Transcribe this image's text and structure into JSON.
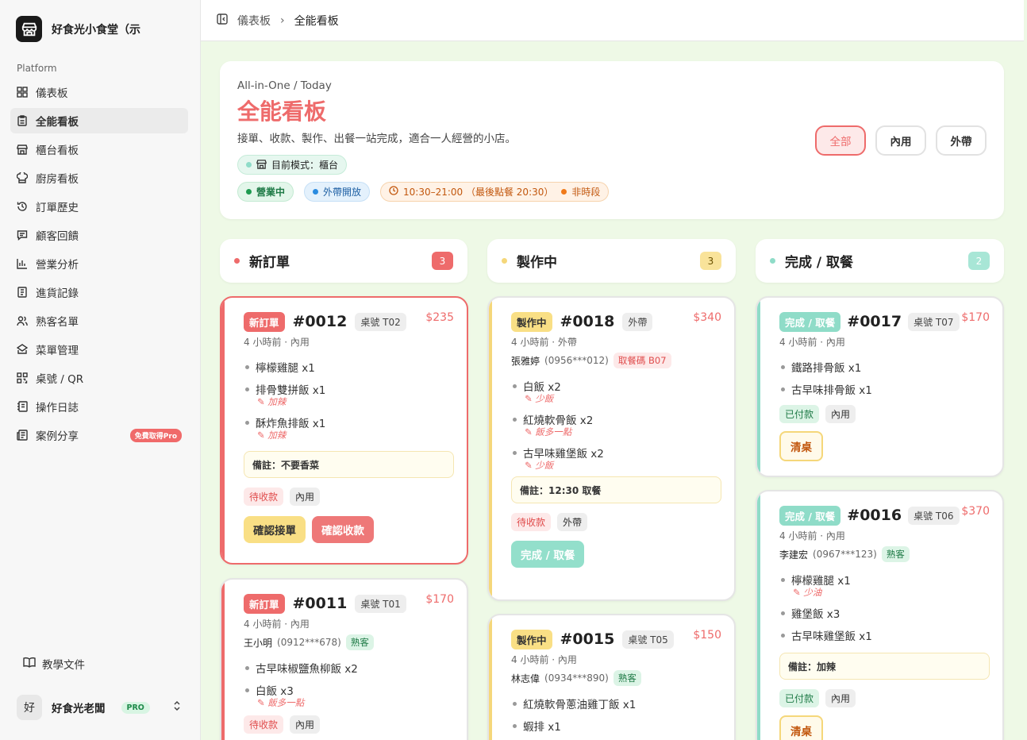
{
  "sidebar": {
    "brand": "好食光小食堂（示",
    "section": "Platform",
    "items": [
      {
        "label": "儀表板",
        "icon": "grid-icon"
      },
      {
        "label": "全能看板",
        "icon": "clipboard-icon"
      },
      {
        "label": "櫃台看板",
        "icon": "store-icon"
      },
      {
        "label": "廚房看板",
        "icon": "chef-hat-icon"
      },
      {
        "label": "訂單歷史",
        "icon": "history-icon"
      },
      {
        "label": "顧客回饋",
        "icon": "message-icon"
      },
      {
        "label": "營業分析",
        "icon": "bar-chart-icon"
      },
      {
        "label": "進貨記錄",
        "icon": "receipt-icon"
      },
      {
        "label": "熟客名單",
        "icon": "users-icon"
      },
      {
        "label": "菜單管理",
        "icon": "menu-icon"
      },
      {
        "label": "桌號 / QR",
        "icon": "qr-icon"
      },
      {
        "label": "操作日誌",
        "icon": "log-icon"
      },
      {
        "label": "案例分享",
        "icon": "newspaper-icon",
        "badge": "免費取得Pro"
      }
    ],
    "docs": "教學文件",
    "user": {
      "initial": "好",
      "name": "好食光老闆",
      "plan": "PRO"
    }
  },
  "breadcrumb": {
    "parent": "儀表板",
    "current": "全能看板"
  },
  "hero": {
    "subtitle": "All-in-One / Today",
    "title": "全能看板",
    "description": "接單、收款、製作、出餐一站完成，適合一人經營的小店。",
    "mode": "目前模式：櫃台",
    "status_open": "營業中",
    "takeout_open": "外帶開放",
    "hours": "10:30–21:00 （最後點餐 20:30）",
    "peak": "非時段"
  },
  "filters": [
    "全部",
    "內用",
    "外帶"
  ],
  "columns": [
    {
      "title": "新訂單",
      "count": "3",
      "color": "#ee6b6b"
    },
    {
      "title": "製作中",
      "count": "3",
      "color": "#f5d77a"
    },
    {
      "title": "完成 / 取餐",
      "count": "2",
      "color": "#8fdcc8"
    }
  ],
  "cards": {
    "c0012": {
      "status": "新訂單",
      "number": "#0012",
      "tag": "桌號 T02",
      "price": "$235",
      "meta": "4 小時前 · 內用",
      "items": [
        {
          "name": "檸檬雞腿 x1",
          "note": ""
        },
        {
          "name": "排骨雙拼飯 x1",
          "note": "✎ 加辣"
        },
        {
          "name": "酥炸魚排飯 x1",
          "note": "✎ 加辣"
        }
      ],
      "remark": "備註：不要香菜",
      "pay": "待收款",
      "type": "內用",
      "btn1": "確認接單",
      "btn2": "確認收款"
    },
    "c0011": {
      "status": "新訂單",
      "number": "#0011",
      "tag": "桌號 T01",
      "price": "$170",
      "meta": "4 小時前 · 內用",
      "customer": "王小明",
      "phone": "(0912***678)",
      "vip": "熟客",
      "items": [
        {
          "name": "古早味椒鹽魚柳飯 x2",
          "note": ""
        },
        {
          "name": "白飯 x3",
          "note": "✎ 飯多一點"
        }
      ],
      "pay": "待收款",
      "type": "內用"
    },
    "c0018": {
      "status": "製作中",
      "number": "#0018",
      "tag": "外帶",
      "price": "$340",
      "meta": "4 小時前 · 外帶",
      "customer": "張雅婷",
      "phone": "(0956***012)",
      "pickup": "取餐碼 B07",
      "items": [
        {
          "name": "白飯 x2",
          "note": "✎ 少飯"
        },
        {
          "name": "紅燒軟骨飯 x2",
          "note": "✎ 飯多一點"
        },
        {
          "name": "古早味雞堡飯 x2",
          "note": "✎ 少飯"
        }
      ],
      "remark": "備註：12:30 取餐",
      "pay": "待收款",
      "type": "外帶",
      "btn1": "完成 / 取餐"
    },
    "c0015": {
      "status": "製作中",
      "number": "#0015",
      "tag": "桌號 T05",
      "price": "$150",
      "meta": "4 小時前 · 內用",
      "customer": "林志偉",
      "phone": "(0934***890)",
      "vip": "熟客",
      "items": [
        {
          "name": "紅燒軟骨蔥油雞丁飯 x1",
          "note": ""
        },
        {
          "name": "蝦排 x1",
          "note": ""
        }
      ]
    },
    "c0017": {
      "status": "完成 / 取餐",
      "number": "#0017",
      "tag": "桌號 T07",
      "price": "$170",
      "meta": "4 小時前 · 內用",
      "items": [
        {
          "name": "鐵路排骨飯 x1",
          "note": ""
        },
        {
          "name": "古早味排骨飯 x1",
          "note": ""
        }
      ],
      "pay": "已付款",
      "type": "內用",
      "btn1": "清桌"
    },
    "c0016": {
      "status": "完成 / 取餐",
      "number": "#0016",
      "tag": "桌號 T06",
      "price": "$370",
      "meta": "4 小時前 · 內用",
      "customer": "李建宏",
      "phone": "(0967***123)",
      "vip": "熟客",
      "items": [
        {
          "name": "檸檬雞腿 x1",
          "note": "✎ 少油"
        },
        {
          "name": "雞堡飯 x3",
          "note": ""
        },
        {
          "name": "古早味雞堡飯 x1",
          "note": ""
        }
      ],
      "remark": "備註：加辣",
      "pay": "已付款",
      "type": "內用",
      "btn1": "清桌"
    }
  }
}
